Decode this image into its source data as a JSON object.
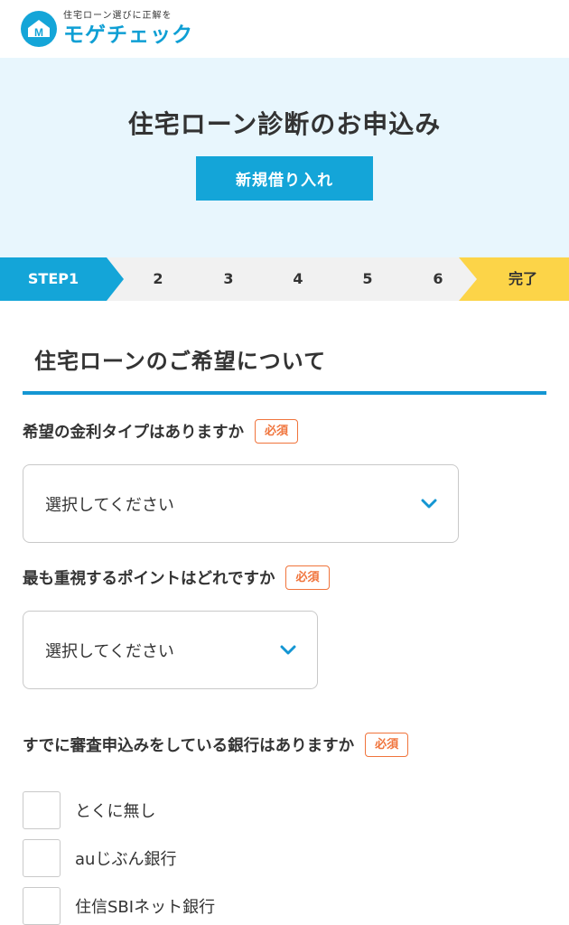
{
  "header": {
    "tagline": "住宅ローン選びに正解を",
    "site_name": "モゲチェック",
    "logo_letter": "M"
  },
  "hero": {
    "title": "住宅ローン診断のお申込み",
    "button_label": "新規借り入れ"
  },
  "steps": {
    "active_label": "STEP1",
    "numbers": [
      "2",
      "3",
      "4",
      "5",
      "6"
    ],
    "done_label": "完了"
  },
  "section": {
    "title": "住宅ローンのご希望について"
  },
  "questions": {
    "rate_type": {
      "label": "希望の金利タイプはありますか",
      "badge": "必須",
      "selected": "選択してください"
    },
    "priority": {
      "label": "最も重視するポイントはどれですか",
      "badge": "必須",
      "selected": "選択してください"
    },
    "applied_banks": {
      "label": "すでに審査申込みをしている銀行はありますか",
      "badge": "必須",
      "options": [
        "とくに無し",
        "auじぶん銀行",
        "住信SBIネット銀行"
      ]
    }
  },
  "colors": {
    "brand_blue": "#14a5d8",
    "hero_bg": "#e8f6fd",
    "step_done": "#fcd448",
    "required_badge": "#f0743c"
  }
}
